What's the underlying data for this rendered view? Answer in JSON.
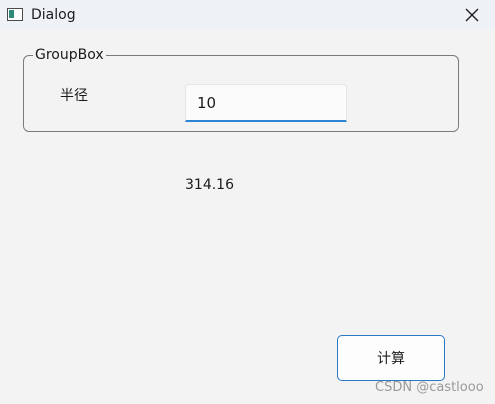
{
  "window": {
    "title": "Dialog",
    "icon": "window-app-icon"
  },
  "groupbox": {
    "title": "GroupBox",
    "radius_label": "半径",
    "radius_value": "10"
  },
  "result": {
    "value": "314.16"
  },
  "actions": {
    "compute_label": "计算"
  },
  "watermark": {
    "text": "CSDN @castlooo"
  },
  "colors": {
    "accent": "#2f84d2",
    "background": "#f3f3f3",
    "titlebar": "#eef2f7"
  }
}
